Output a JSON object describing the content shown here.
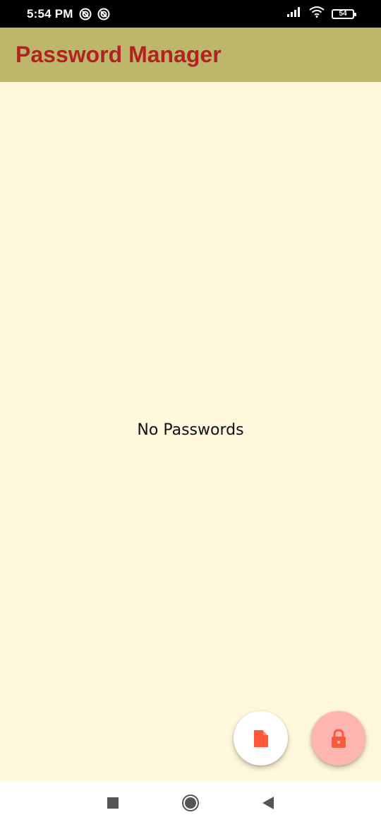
{
  "status_bar": {
    "time": "5:54 PM",
    "battery_level": "54",
    "icons": [
      "sync-icon",
      "sync-icon",
      "signal-icon",
      "wifi-icon",
      "battery-icon"
    ]
  },
  "app_bar": {
    "title": "Password Manager"
  },
  "main": {
    "empty_message": "No Passwords"
  },
  "fabs": [
    {
      "icon": "file-icon"
    },
    {
      "icon": "lock-icon"
    }
  ],
  "nav_bar": {
    "buttons": [
      "recents-icon",
      "home-icon",
      "back-icon"
    ]
  },
  "colors": {
    "app_bar_bg": "#BDB76B",
    "title": "#B22222",
    "background": "#FFF8DC",
    "icon_accent": "#FF5A3C",
    "lock_fab_bg": "#FFB6B0"
  }
}
